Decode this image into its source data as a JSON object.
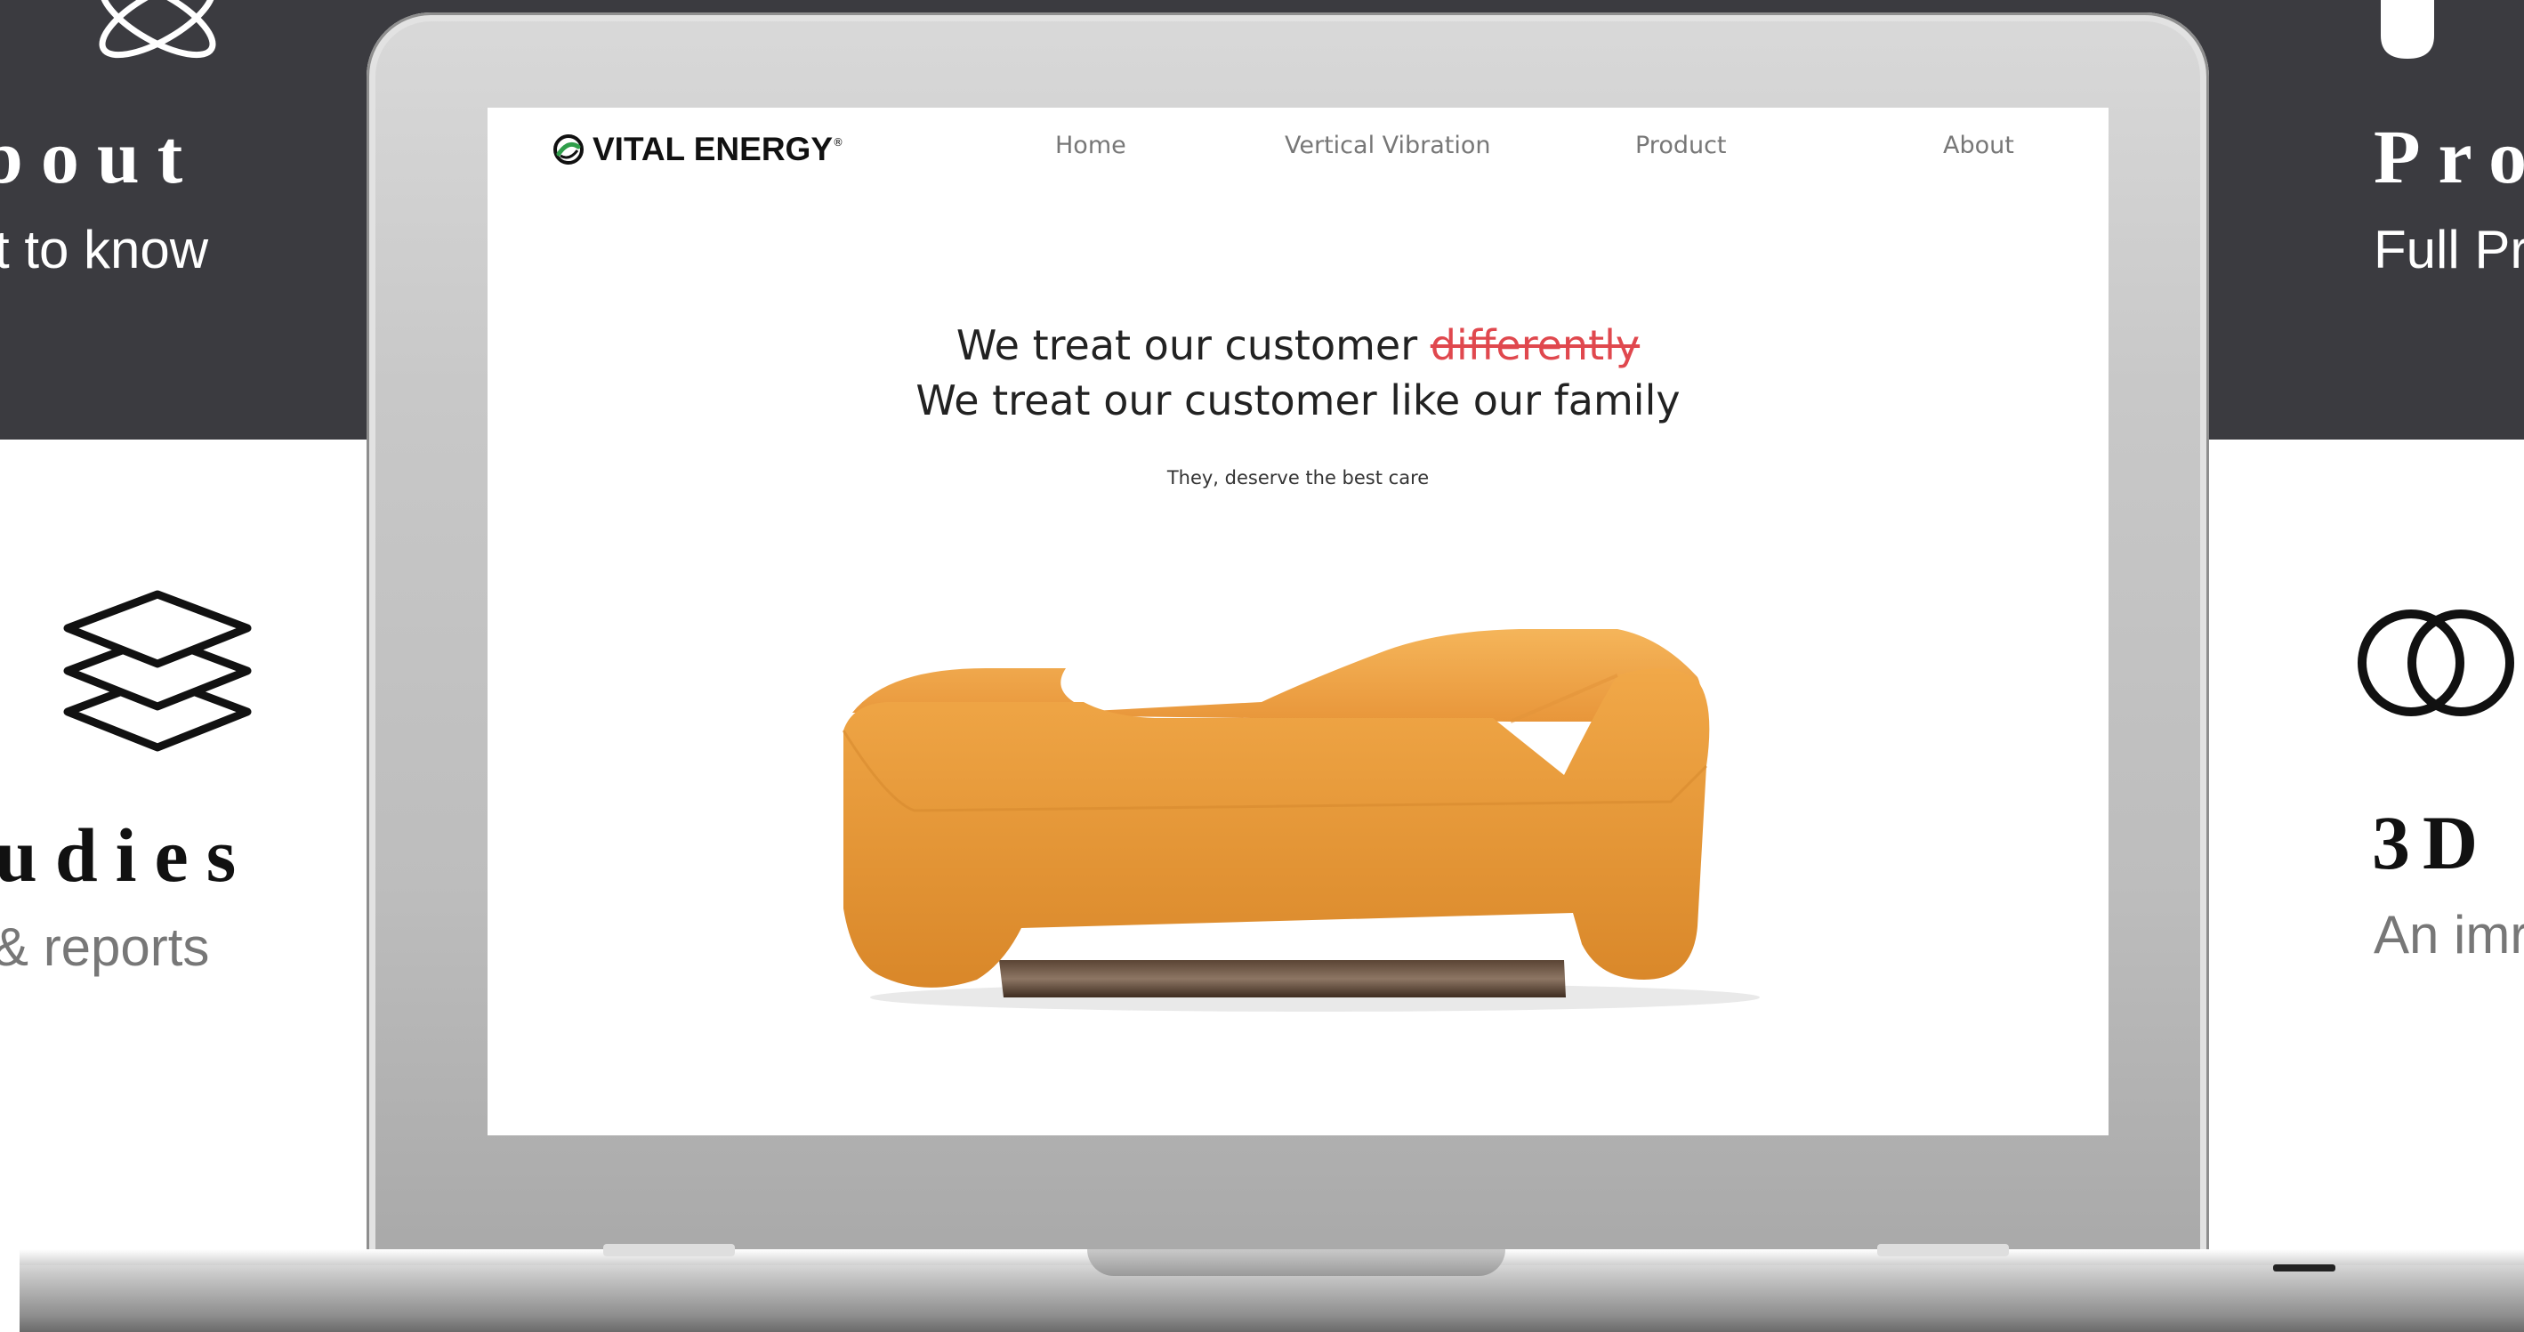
{
  "background": {
    "left": {
      "about_title": "bout",
      "about_subtitle": "t to know",
      "studies_title": "udies",
      "studies_subtitle": "& reports"
    },
    "right": {
      "product_title": "Pro",
      "product_subtitle": "Full Pr",
      "threed_title": "3D",
      "threed_subtitle": "An imr"
    },
    "colors": {
      "dark_band": "#3b3b40"
    }
  },
  "site": {
    "logo_text": "VITAL ENERGY",
    "logo_registered": "®",
    "nav": [
      "Home",
      "Vertical Vibration",
      "Product",
      "About"
    ],
    "hero": {
      "line1_prefix": "We treat our customer ",
      "line1_struck": "differently",
      "line2": "We treat our customer like our family",
      "sub": "They, deserve the best care"
    },
    "colors": {
      "accent_strike": "#e0484e",
      "sofa": "#f0a23c"
    }
  }
}
